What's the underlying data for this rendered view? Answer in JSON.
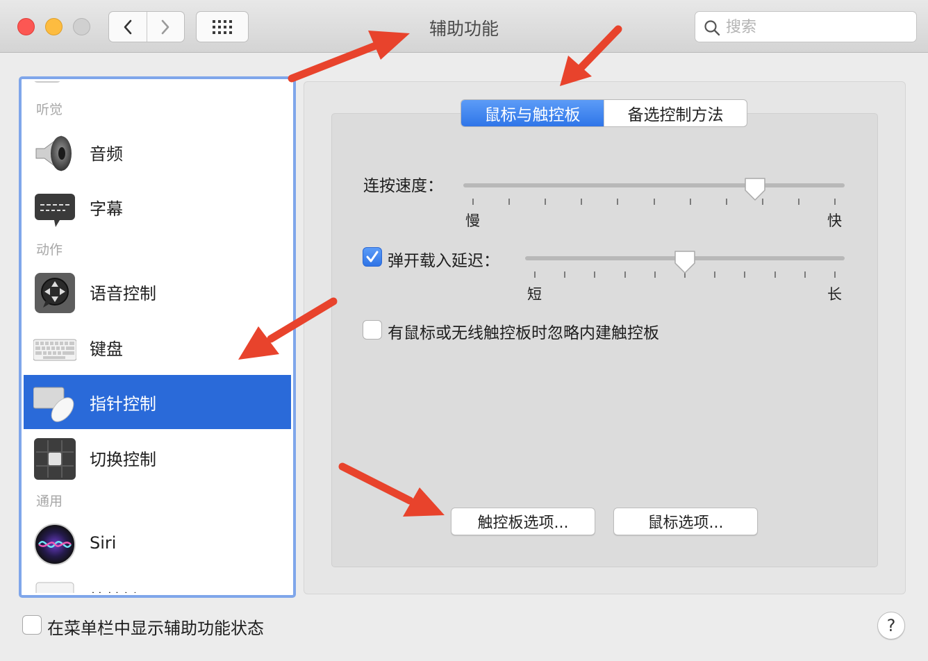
{
  "window": {
    "title": "辅助功能",
    "search_placeholder": "搜索"
  },
  "sidebar": {
    "sections": [
      {
        "header": "听觉",
        "items": [
          {
            "label": "音频",
            "icon": "speaker-icon"
          },
          {
            "label": "字幕",
            "icon": "captions-icon"
          }
        ]
      },
      {
        "header": "动作",
        "items": [
          {
            "label": "语音控制",
            "icon": "voice-control-icon"
          },
          {
            "label": "键盘",
            "icon": "keyboard-icon"
          },
          {
            "label": "指针控制",
            "icon": "pointer-control-icon",
            "selected": true
          },
          {
            "label": "切换控制",
            "icon": "switch-control-icon"
          }
        ]
      },
      {
        "header": "通用",
        "items": [
          {
            "label": "Siri",
            "icon": "siri-icon"
          },
          {
            "label": "快捷键",
            "icon": "shortcut-icon"
          }
        ]
      }
    ]
  },
  "tabs": {
    "active": "鼠标与触控板",
    "inactive": "备选控制方法"
  },
  "double_click_speed": {
    "label": "连按速度：",
    "min_label": "慢",
    "max_label": "快",
    "value_fraction": 0.78,
    "ticks": 11
  },
  "spring_loading": {
    "label": "弹开载入延迟：",
    "checked": true,
    "min_label": "短",
    "max_label": "长",
    "value_fraction": 0.5,
    "ticks": 11
  },
  "ignore_builtin_trackpad": {
    "label": "有鼠标或无线触控板时忽略内建触控板",
    "checked": false
  },
  "buttons": {
    "trackpad_options": "触控板选项...",
    "mouse_options": "鼠标选项..."
  },
  "bottom": {
    "menubar_status_label": "在菜单栏中显示辅助功能状态",
    "menubar_status_checked": false,
    "help_label": "?"
  },
  "colors": {
    "accent": "#2a6ad9",
    "annotation_arrow": "#e8432c"
  }
}
